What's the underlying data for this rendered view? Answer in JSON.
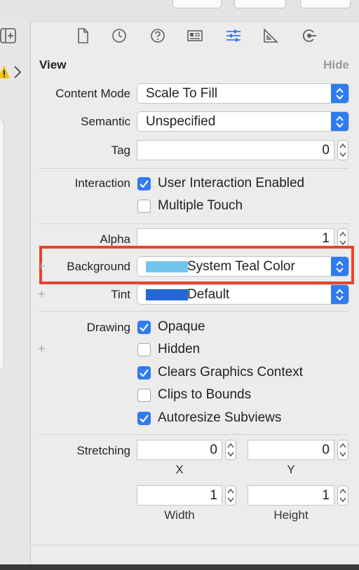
{
  "section": {
    "title": "View",
    "hide_label": "Hide"
  },
  "toolbar": {
    "icons": [
      "file-icon",
      "history-icon",
      "help-icon",
      "identity-icon",
      "attributes-icon",
      "size-ruler-icon",
      "connections-icon"
    ]
  },
  "content_mode": {
    "label": "Content Mode",
    "value": "Scale To Fill"
  },
  "semantic": {
    "label": "Semantic",
    "value": "Unspecified"
  },
  "tag": {
    "label": "Tag",
    "value": "0"
  },
  "interaction": {
    "label": "Interaction",
    "options": [
      {
        "label": "User Interaction Enabled",
        "checked": true
      },
      {
        "label": "Multiple Touch",
        "checked": false
      }
    ]
  },
  "alpha": {
    "label": "Alpha",
    "value": "1"
  },
  "background": {
    "label": "Background",
    "value": "System Teal Color",
    "swatch": "#74c4f0"
  },
  "tint": {
    "label": "Tint",
    "value": "Default",
    "swatch": "#2168d6"
  },
  "drawing": {
    "label": "Drawing",
    "options": [
      {
        "label": "Opaque",
        "checked": true
      },
      {
        "label": "Hidden",
        "checked": false
      },
      {
        "label": "Clears Graphics Context",
        "checked": true
      },
      {
        "label": "Clips to Bounds",
        "checked": false
      },
      {
        "label": "Autoresize Subviews",
        "checked": true
      }
    ]
  },
  "stretching": {
    "label": "Stretching",
    "x": {
      "label": "X",
      "value": "0"
    },
    "y": {
      "label": "Y",
      "value": "0"
    },
    "width": {
      "label": "Width",
      "value": "1"
    },
    "height": {
      "label": "Height",
      "value": "1"
    }
  },
  "plus_symbol": "+",
  "colors": {
    "accent": "#2f7bf0",
    "highlight_border": "#e8432b",
    "warning": "#f5c400"
  }
}
